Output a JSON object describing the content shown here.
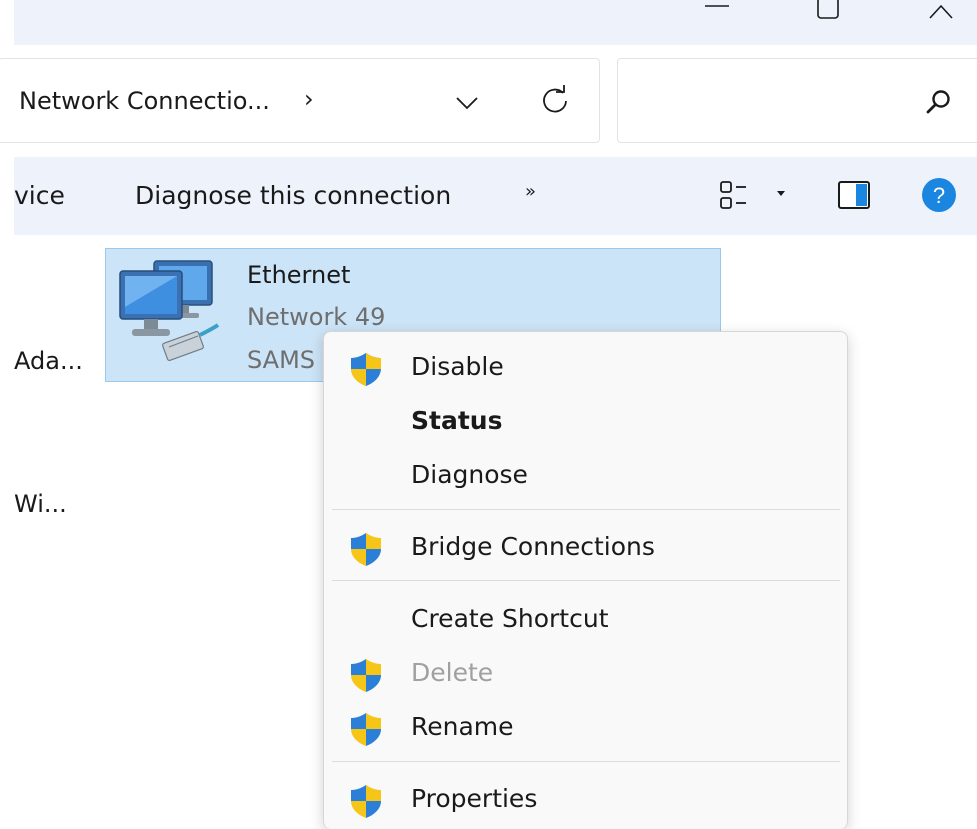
{
  "window": {
    "controls": [
      "minimize",
      "maximize",
      "close"
    ]
  },
  "address": {
    "breadcrumb": "Network Connectio...",
    "separator": "›"
  },
  "search": {
    "placeholder": ""
  },
  "commandbar": {
    "truncated_left": "vice",
    "diagnose_label": "Diagnose this connection",
    "more_label": "»"
  },
  "left_items": [
    {
      "label": "Ada..."
    },
    {
      "label": "Wi..."
    }
  ],
  "connection": {
    "name": "Ethernet",
    "network": "Network 49",
    "device": "SAMS"
  },
  "context_menu": {
    "items": [
      {
        "label": "Disable",
        "shield": true,
        "bold": false,
        "disabled": false
      },
      {
        "label": "Status",
        "shield": false,
        "bold": true,
        "disabled": false
      },
      {
        "label": "Diagnose",
        "shield": false,
        "bold": false,
        "disabled": false
      },
      {
        "label": "Bridge Connections",
        "shield": true,
        "bold": false,
        "disabled": false
      },
      {
        "label": "Create Shortcut",
        "shield": false,
        "bold": false,
        "disabled": false
      },
      {
        "label": "Delete",
        "shield": true,
        "bold": false,
        "disabled": true
      },
      {
        "label": "Rename",
        "shield": true,
        "bold": false,
        "disabled": false
      },
      {
        "label": "Properties",
        "shield": true,
        "bold": false,
        "disabled": false
      }
    ]
  },
  "colors": {
    "titlebar_bg": "#eef3fb",
    "selection_bg": "#cce4f7",
    "selection_border": "#99c9ef",
    "help_blue": "#1a86e0",
    "shield_blue": "#2b7fd6",
    "shield_yellow": "#f5c518"
  },
  "icons": [
    "minimize-icon",
    "maximize-icon",
    "close-icon",
    "chevron-down-icon",
    "refresh-icon",
    "search-icon",
    "view-options-icon",
    "preview-pane-icon",
    "help-icon",
    "network-adapter-icon",
    "uac-shield-icon"
  ]
}
